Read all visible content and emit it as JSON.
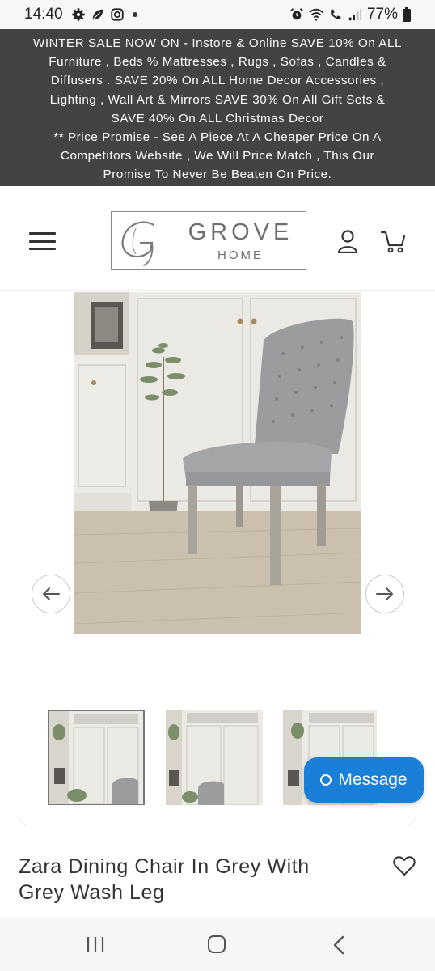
{
  "status_bar": {
    "time": "14:40",
    "battery": "77%",
    "left_icons": [
      "gear-icon",
      "leaf-icon",
      "instagram-icon"
    ],
    "right_icons": [
      "alarm-icon",
      "wifi-icon",
      "call-icon",
      "signal-icon",
      "battery-icon"
    ]
  },
  "banner": {
    "lines": [
      "WINTER SALE NOW ON - Instore & Online SAVE 10% On ALL",
      "Furniture , Beds % Mattresses , Rugs , Sofas , Candles &",
      "Diffusers . SAVE 20% On ALL Home Decor Accessories ,",
      "Lighting , Wall Art & Mirrors SAVE 30% On All Gift Sets &",
      "SAVE 40% On ALL Christmas Decor",
      "** Price Promise - See A Piece At A Cheaper Price On A",
      "Competitors Website , We Will Price Match , This Our",
      "Promise To Never Be Beaten On Price."
    ],
    "background": "#414441"
  },
  "header": {
    "logo": {
      "monogram": "G",
      "title": "GROVE",
      "subtitle": "HOME"
    }
  },
  "product": {
    "title": "Zara Dining Chair In Grey With Grey Wash Leg",
    "thumbnails_count": 3,
    "active_thumbnail": 1
  },
  "chat": {
    "label": "Message",
    "color": "#1a7fd6"
  }
}
